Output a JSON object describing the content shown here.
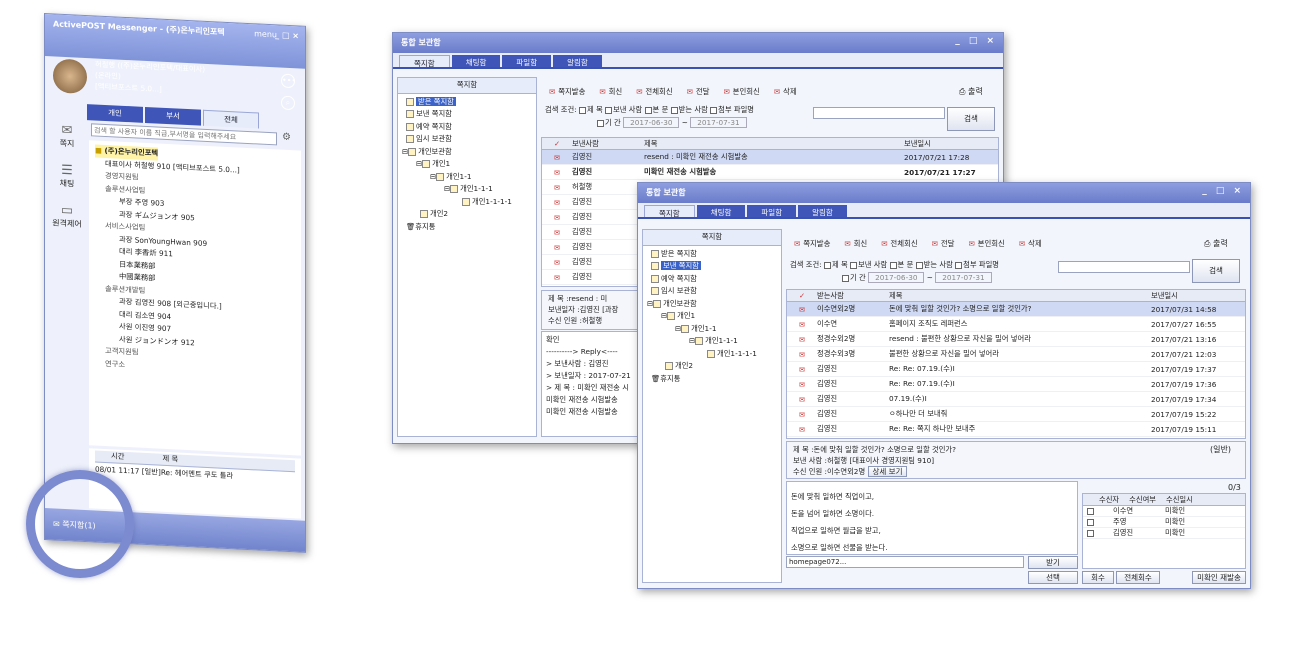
{
  "messenger": {
    "title": "ActivePOST Messenger - (주)온누리인포텍",
    "menu": "menu",
    "user": "허철행 ((주)온누리인포텍/대표이사)",
    "status": "(온라인)",
    "note": "[액티브포스트 5.0...]",
    "tabs": [
      "개인",
      "부서",
      "전체"
    ],
    "search_ph": "검색 할 사용자 이름 직급,부서명을 입력해주세요",
    "side": [
      "쪽지",
      "채팅",
      "원격제어"
    ],
    "tree": [
      "(주)온누리인포텍",
      "대표이사 허철행 910 [액티브포스트 5.0...]",
      "경영지원팀",
      "솔루션사업팀",
      "부장 주영 903",
      "과장 ギムジョンオ 905",
      "서비스사업팀",
      "과장 SonYoungHwan 909",
      "대리 李香炘 911",
      "日本業務部",
      "中國業務部",
      "솔루션개발팀",
      "과장 김영진 908 [외근중입니다.]",
      "대리 김소연 904",
      "사원 이진영 907",
      "사원 ジョンドンオ 912",
      "고객지원팀",
      "연구소"
    ],
    "log_head": [
      "시간",
      "제 목"
    ],
    "log_row": "08/01 11:17  [일반]Re: 헤어멘트 쿠도 틀라",
    "status_label": "쪽지함(1)"
  },
  "w1": {
    "title": "통합 보관함",
    "tabs": [
      "쪽지함",
      "채팅함",
      "파일함",
      "알림함"
    ],
    "tree_head": "쪽지함",
    "tree": [
      "받은 쪽지함",
      "보낸 쪽지함",
      "예약 쪽지함",
      "임시 보관함",
      "개인보관함",
      "개인1",
      "개인1-1",
      "개인1-1-1",
      "개인1-1-1-1",
      "개인2",
      "휴지통"
    ],
    "toolbar": [
      "쪽지발송",
      "회신",
      "전체회신",
      "전달",
      "본인회신",
      "삭제"
    ],
    "print": "출력",
    "search": {
      "label": "검색 조건:",
      "opts": [
        "제 목",
        "보낸 사람",
        "본 문",
        "받는 사람",
        "첨부 파일명"
      ],
      "period": "기 간",
      "from": "2017-06-30",
      "to": "2017-07-31",
      "btn": "검색"
    },
    "cols": [
      "보낸사람",
      "제목",
      "보낸일시"
    ],
    "rows": [
      [
        "김영진",
        "resend : 미확인 재전송 시험발송",
        "2017/07/21 17:28"
      ],
      [
        "김영진",
        "미확인 재전송 시험발송",
        "2017/07/21 17:27"
      ],
      [
        "허철행",
        "",
        ""
      ],
      [
        "김영진",
        "",
        ""
      ],
      [
        "김영진",
        "",
        ""
      ],
      [
        "김영진",
        "",
        ""
      ],
      [
        "김영진",
        "",
        ""
      ],
      [
        "김영진",
        "",
        ""
      ],
      [
        "김영진",
        "",
        ""
      ]
    ],
    "meta": [
      "제     목 :resend : 미",
      "보낸일자 :김영진 [과장",
      "수신 인원 :허철행"
    ],
    "body": [
      "확인",
      "",
      "----------> Reply<----",
      "> 보낸사람 : 김영진",
      "> 보낸일자 : 2017-07-21",
      "> 제 목 : 미확인 재전송 시",
      "",
      "미확인 재전송 시험발송",
      "미확인 재전송 시험발송"
    ]
  },
  "w2": {
    "title": "통합 보관함",
    "tabs": [
      "쪽지함",
      "채팅함",
      "파일함",
      "알림함"
    ],
    "tree_head": "쪽지함",
    "tree": [
      "받은 쪽지함",
      "보낸 쪽지함",
      "예약 쪽지함",
      "임시 보관함",
      "개인보관함",
      "개인1",
      "개인1-1",
      "개인1-1-1",
      "개인1-1-1-1",
      "개인2",
      "휴지통"
    ],
    "toolbar": [
      "쪽지발송",
      "회신",
      "전체회신",
      "전달",
      "본인회신",
      "삭제"
    ],
    "print": "출력",
    "search": {
      "label": "검색 조건:",
      "opts": [
        "제 목",
        "보낸 사람",
        "본 문",
        "받는 사람",
        "첨부 파일명"
      ],
      "period": "기 간",
      "from": "2017-06-30",
      "to": "2017-07-31",
      "btn": "검색"
    },
    "cols": [
      "받는사람",
      "제목",
      "보낸일시"
    ],
    "rows": [
      [
        "이수연외2명",
        "돈에 맞춰 일할 것인가? 소명으로 일할 것인가?",
        "2017/07/31 14:58"
      ],
      [
        "이수연",
        "홈페이지 조직도 레퍼런스",
        "2017/07/27 16:55"
      ],
      [
        "정경수외2명",
        "resend : 불편한 상황으로 자신을 밀어 넣어라",
        "2017/07/21 13:16"
      ],
      [
        "정경수외3명",
        "불편한 상황으로 자신을 밀어 넣어라",
        "2017/07/21 12:03"
      ],
      [
        "김영진",
        "Re: Re: 07.19.(수)I",
        "2017/07/19 17:37"
      ],
      [
        "김영진",
        "Re: Re: 07.19.(수)I",
        "2017/07/19 17:36"
      ],
      [
        "김영진",
        "07.19.(수)I",
        "2017/07/19 17:34"
      ],
      [
        "김영진",
        "ㅇ하나만 더 보내줘",
        "2017/07/19 15:22"
      ],
      [
        "김영진",
        "Re: Re: 쪽지 하나만 보내주",
        "2017/07/19 15:11"
      ]
    ],
    "meta": [
      "제      목 :돈에 맞춰 일할 것인가? 소명으로 일할 것인가?",
      "보낸 사람 :허철행 [대표이사 경영지원팀 910]",
      "수신 인원 :이수연외2명"
    ],
    "meta_tag": "(일반)",
    "detail": "상세 보기",
    "body": [
      "돈에 맞춰 일하면 직업이고,",
      "돈을 넘어 일하면 소명이다.",
      "직업으로 일하면 월급을 받고,",
      "소명으로 일하면 선물을 받는다."
    ],
    "attach": "homepage072...",
    "recv_btn": "받기",
    "select_btn": "선택",
    "count": "0/3",
    "rcols": [
      "수신자",
      "수신여부",
      "수신일시"
    ],
    "recips": [
      [
        "이수연",
        "미확인"
      ],
      [
        "주영",
        "미확인"
      ],
      [
        "김영진",
        "미확인"
      ]
    ],
    "rbtns": [
      "회수",
      "전체회수",
      "미확인 재발송"
    ]
  }
}
